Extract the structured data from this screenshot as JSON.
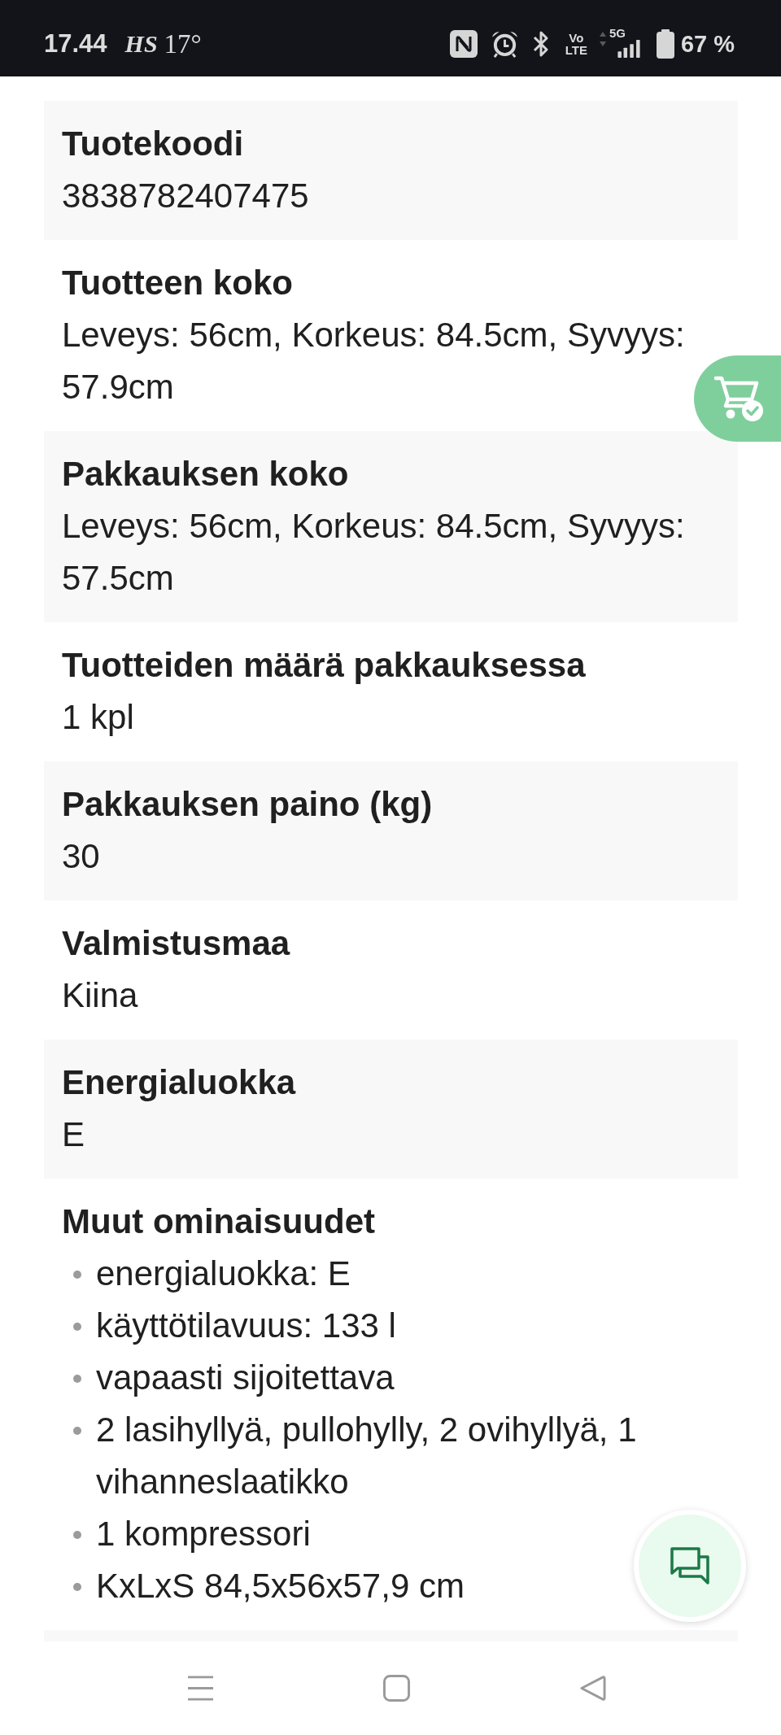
{
  "status_bar": {
    "time": "17.44",
    "notification": "HS",
    "temperature": "17°",
    "volte": [
      "Vo",
      "LTE"
    ],
    "network": "5G",
    "battery": "67 %"
  },
  "details": [
    {
      "kind": "text",
      "label": "Tuotekoodi",
      "value": "3838782407475"
    },
    {
      "kind": "text",
      "label": "Tuotteen koko",
      "value": "Leveys: 56cm, Korkeus: 84.5cm, Syvyys: 57.9cm"
    },
    {
      "kind": "text",
      "label": "Pakkauksen koko",
      "value": "Leveys: 56cm, Korkeus: 84.5cm, Syvyys: 57.5cm"
    },
    {
      "kind": "text",
      "label": "Tuotteiden määrä pakkauksessa",
      "value": "1 kpl"
    },
    {
      "kind": "text",
      "label": "Pakkauksen paino (kg)",
      "value": "30"
    },
    {
      "kind": "text",
      "label": "Valmistusmaa",
      "value": "Kiina"
    },
    {
      "kind": "text",
      "label": "Energialuokka",
      "value": "E"
    },
    {
      "kind": "list",
      "label": "Muut ominaisuudet",
      "items": [
        "energialuokka: E",
        "käyttötilavuus: 133 l",
        "vapaasti sijoitettava",
        "2 lasihyllyä, pullohylly, 2 ovihyllyä, 1 vihanneslaatikko",
        "1 kompressori",
        "KxLxS 84,5x56x57,9 cm"
      ]
    }
  ]
}
